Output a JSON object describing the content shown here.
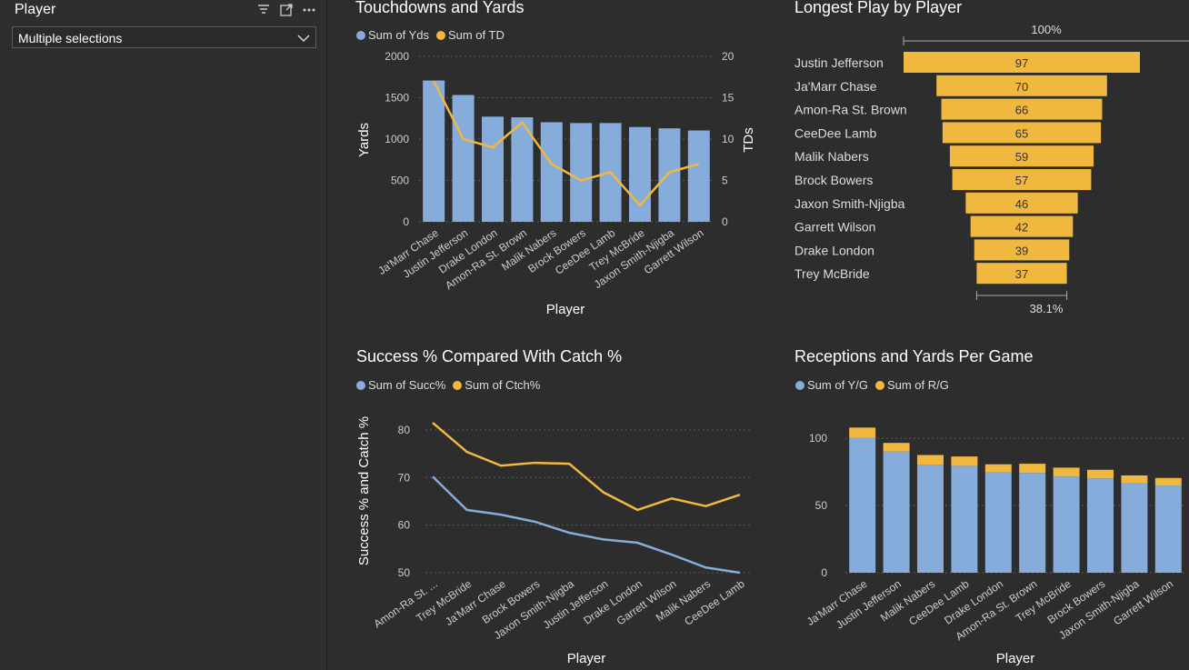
{
  "slicer": {
    "title": "Player",
    "selected": "Multiple selections",
    "icons": [
      "filter-icon",
      "focus-mode-icon",
      "more-options-icon"
    ]
  },
  "colors": {
    "blue": "#86acdc",
    "yellow": "#f1b83f",
    "grid": "#5c5c5c"
  },
  "charts": {
    "td_yards": {
      "title": "Touchdowns and Yards",
      "legend": [
        "Sum of Yds",
        "Sum of TD"
      ],
      "xlabel": "Player",
      "ylabel": "Yards",
      "y2label": "TDs"
    },
    "longest": {
      "title": "Longest Play by Player",
      "top_pct": "100%",
      "bottom_pct": "38.1%"
    },
    "success": {
      "title": "Success % Compared With Catch %",
      "legend": [
        "Sum of Succ%",
        "Sum of Ctch%"
      ],
      "xlabel": "Player",
      "ylabel": "Success % and Catch %"
    },
    "rec_yards": {
      "title": "Receptions and Yards Per Game",
      "legend": [
        "Sum of Y/G",
        "Sum of R/G"
      ],
      "xlabel": "Player"
    }
  },
  "chart_data": [
    {
      "type": "bar",
      "title": "Touchdowns and Yards",
      "categories": [
        "Ja'Marr Chase",
        "Justin Jefferson",
        "Drake London",
        "Amon-Ra St. Brown",
        "Malik Nabers",
        "Brock Bowers",
        "CeeDee Lamb",
        "Trey McBride",
        "Jaxon Smith-Njigba",
        "Garrett Wilson"
      ],
      "series": [
        {
          "name": "Sum of Yds",
          "values": [
            1708,
            1533,
            1271,
            1263,
            1204,
            1194,
            1194,
            1146,
            1130,
            1104
          ],
          "axis": "left"
        },
        {
          "name": "Sum of TD",
          "values": [
            17,
            10,
            9,
            12,
            7,
            5,
            6,
            2,
            6,
            7
          ],
          "axis": "right",
          "type": "line"
        }
      ],
      "xlabel": "Player",
      "ylabel": "Yards",
      "y2label": "TDs",
      "yticks": [
        "0",
        "500",
        "1000",
        "1500",
        "2000"
      ],
      "y2ticks": [
        "0",
        "5",
        "10",
        "15",
        "20"
      ],
      "ylim": [
        0,
        2000
      ],
      "y2lim": [
        0,
        20
      ]
    },
    {
      "type": "bar",
      "title": "Longest Play by Player",
      "orientation": "horizontal-funnel",
      "categories": [
        "Justin Jefferson",
        "Ja'Marr Chase",
        "Amon-Ra St. Brown",
        "CeeDee Lamb",
        "Malik Nabers",
        "Brock Bowers",
        "Jaxon Smith-Njigba",
        "Garrett Wilson",
        "Drake London",
        "Trey McBride"
      ],
      "values": [
        97,
        70,
        66,
        65,
        59,
        57,
        46,
        42,
        39,
        37
      ],
      "data_labels": [
        "97",
        "70",
        "66",
        "65",
        "59",
        "57",
        "46",
        "42",
        "39",
        "37"
      ],
      "annotations": [
        "100%",
        "38.1%"
      ]
    },
    {
      "type": "line",
      "title": "Success % Compared With Catch %",
      "categories": [
        "Amon-Ra St. ...",
        "Trey McBride",
        "Ja'Marr Chase",
        "Brock Bowers",
        "Jaxon Smith-Njigba",
        "Justin Jefferson",
        "Drake London",
        "Garrett Wilson",
        "Malik Nabers",
        "CeeDee Lamb"
      ],
      "series": [
        {
          "name": "Sum of Succ%",
          "values": [
            70.2,
            63.2,
            62.2,
            60.7,
            58.4,
            57.0,
            56.3,
            53.8,
            51.1,
            50.0
          ]
        },
        {
          "name": "Sum of Ctch%",
          "values": [
            81.5,
            75.4,
            72.5,
            73.1,
            72.9,
            66.9,
            63.2,
            65.6,
            64.0,
            66.4
          ]
        }
      ],
      "xlabel": "Player",
      "ylabel": "Success % and Catch %",
      "yticks": [
        "50",
        "60",
        "70",
        "80"
      ],
      "ylim": [
        50,
        84
      ]
    },
    {
      "type": "bar",
      "stacked": true,
      "title": "Receptions and Yards Per Game",
      "categories": [
        "Ja'Marr Chase",
        "Justin Jefferson",
        "Malik Nabers",
        "CeeDee Lamb",
        "Drake London",
        "Amon-Ra St. Brown",
        "Trey McBride",
        "Brock Bowers",
        "Jaxon Smith-Njigba",
        "Garrett Wilson"
      ],
      "series": [
        {
          "name": "Sum of Y/G",
          "values": [
            100.5,
            90.2,
            80.3,
            79.6,
            74.8,
            74.3,
            71.6,
            70.2,
            66.5,
            64.9
          ]
        },
        {
          "name": "Sum of R/G",
          "values": [
            7.5,
            6.4,
            7.3,
            6.9,
            5.9,
            6.8,
            6.6,
            6.4,
            5.9,
            5.6
          ]
        }
      ],
      "xlabel": "Player",
      "yticks": [
        "0",
        "50",
        "100"
      ],
      "ylim": [
        0,
        115
      ]
    }
  ]
}
